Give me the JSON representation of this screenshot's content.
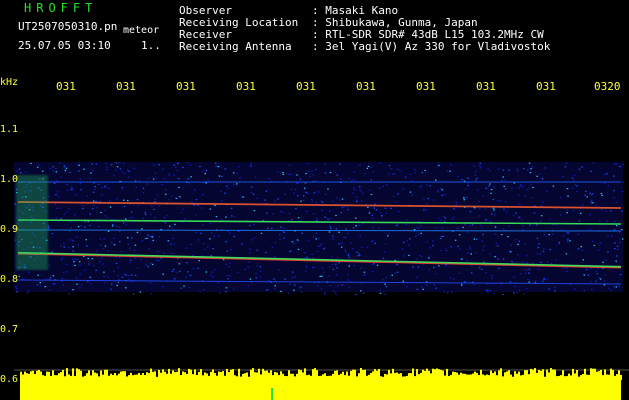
{
  "header": {
    "title": "HROFFT",
    "filename": "UT2507050310.pn",
    "meteor_label": "meteor",
    "datetime": "25.07.05 03:10",
    "mark": "1..",
    "info": [
      {
        "label": "Observer",
        "value": ": Masaki Kano"
      },
      {
        "label": "Receiving Location",
        "value": ": Shibukawa, Gunma, Japan"
      },
      {
        "label": "Receiver",
        "value": ": RTL-SDR SDR# 43dB L15 103.2MHz CW"
      },
      {
        "label": "Receiving Antenna",
        "value": ": 3el Yagi(V) Az 330 for Vladivostok"
      }
    ]
  },
  "axis": {
    "unit": "kHz",
    "y_labels": [
      "1.1",
      "1.0",
      "0.9",
      "0.8",
      "0.7",
      "0.6"
    ],
    "x_ticks": [
      "031",
      "031",
      "031",
      "031",
      "031",
      "031",
      "031",
      "031",
      "031",
      "0320"
    ]
  },
  "colors": {
    "title": "#28e028",
    "labels": "#ffff3a",
    "text": "#ffffff",
    "noise_band": "#ffff00"
  }
}
